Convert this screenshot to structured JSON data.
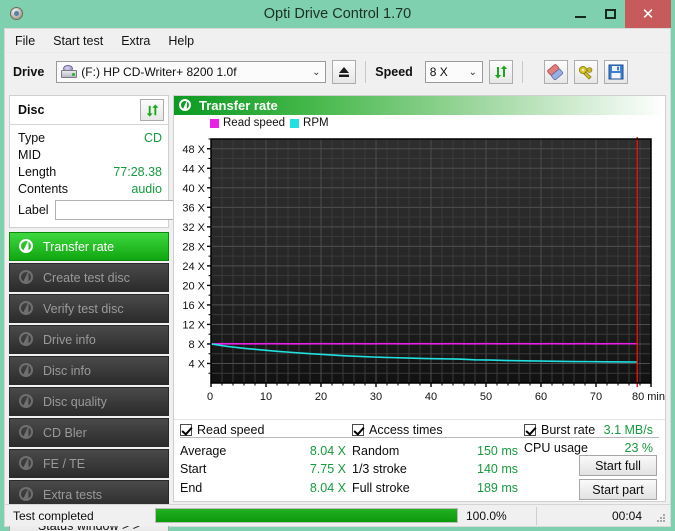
{
  "window": {
    "title": "Opti Drive Control 1.70",
    "icon": "disc-icon",
    "minimize_label": "–",
    "maximize_label": "□",
    "close_label": "✕",
    "titlebar_color": "#7fd0ae",
    "close_color": "#c75b5b"
  },
  "menu": {
    "items": [
      {
        "label": "File"
      },
      {
        "label": "Start test"
      },
      {
        "label": "Extra"
      },
      {
        "label": "Help"
      }
    ]
  },
  "toolbar": {
    "drive_label": "Drive",
    "drive_value": "(F:)   HP CD-Writer+ 8200 1.0f",
    "drive_arrow": "⌄",
    "eject_title": "eject-button",
    "speed_label": "Speed",
    "speed_value": "8 X",
    "speed_arrow": "⌄",
    "refresh_title": "refresh-button",
    "erase_title": "erase-button",
    "tools_title": "tools-button",
    "save_title": "save-button"
  },
  "disc_panel": {
    "header": "Disc",
    "refresh_icon": "refresh-icon",
    "rows": [
      {
        "key": "Type",
        "value": "CD"
      },
      {
        "key": "MID",
        "value": ""
      },
      {
        "key": "Length",
        "value": "77:28.38"
      },
      {
        "key": "Contents",
        "value": "audio"
      }
    ],
    "label_key": "Label",
    "label_value": "",
    "label_placeholder": "",
    "cd_button_icon": "cd-icon"
  },
  "sidebar": {
    "items": [
      {
        "label": "Transfer rate",
        "active": true
      },
      {
        "label": "Create test disc",
        "active": false
      },
      {
        "label": "Verify test disc",
        "active": false
      },
      {
        "label": "Drive info",
        "active": false
      },
      {
        "label": "Disc info",
        "active": false
      },
      {
        "label": "Disc quality",
        "active": false
      },
      {
        "label": "CD Bler",
        "active": false
      },
      {
        "label": "FE / TE",
        "active": false
      },
      {
        "label": "Extra tests",
        "active": false
      }
    ],
    "status_window_label": "Status window > >"
  },
  "panel": {
    "title": "Transfer rate",
    "icon": "transfer-rate-icon"
  },
  "chart_data": {
    "type": "line",
    "title": "Transfer rate",
    "xlabel": "min",
    "ylabel": "X",
    "xlim": [
      0,
      80
    ],
    "ylim": [
      0,
      50
    ],
    "xticks": [
      0,
      10,
      20,
      30,
      40,
      50,
      60,
      70,
      80
    ],
    "xtick_labels": [
      "0",
      "10",
      "20",
      "30",
      "40",
      "50",
      "60",
      "70",
      "80 min"
    ],
    "yticks": [
      4,
      8,
      12,
      16,
      20,
      24,
      28,
      32,
      36,
      40,
      44,
      48
    ],
    "ytick_labels": [
      "4 X",
      "8 X",
      "12 X",
      "16 X",
      "20 X",
      "24 X",
      "28 X",
      "32 X",
      "36 X",
      "40 X",
      "44 X",
      "48 X"
    ],
    "grid": true,
    "legend_position": "top-left",
    "background": "#222222",
    "marker_line": {
      "x": 77.5,
      "color": "#e81010",
      "label": "end-of-disc-marker"
    },
    "series": [
      {
        "name": "Read speed",
        "color": "#e820e8",
        "x": [
          0,
          2,
          5,
          8,
          11,
          14,
          17,
          20,
          23,
          26,
          29,
          32,
          35,
          38,
          41,
          44,
          47,
          50,
          53,
          56,
          59,
          62,
          65,
          68,
          71,
          74,
          77.5
        ],
        "values": [
          8.0,
          8.05,
          8.04,
          8.04,
          8.05,
          8.04,
          8.03,
          8.05,
          8.04,
          8.06,
          8.04,
          8.05,
          8.04,
          8.05,
          8.04,
          8.06,
          8.04,
          8.05,
          8.04,
          8.05,
          8.04,
          8.06,
          8.04,
          8.05,
          8.04,
          8.05,
          8.04
        ]
      },
      {
        "name": "RPM",
        "color": "#20e0e0",
        "x": [
          0,
          3,
          6,
          9,
          12,
          15,
          18,
          21,
          24,
          27,
          30,
          33,
          36,
          39,
          42,
          45,
          48,
          51,
          54,
          57,
          60,
          63,
          66,
          69,
          72,
          75,
          77.5
        ],
        "values": [
          8.0,
          7.5,
          7.1,
          6.8,
          6.5,
          6.25,
          6.0,
          5.8,
          5.6,
          5.45,
          5.3,
          5.2,
          5.1,
          5.0,
          4.95,
          4.9,
          4.75,
          4.7,
          4.6,
          4.55,
          4.5,
          4.45,
          4.4,
          4.38,
          4.35,
          4.32,
          4.3
        ]
      }
    ]
  },
  "results": {
    "read_speed": {
      "header": "Read speed",
      "checked": true,
      "rows": [
        {
          "key": "Average",
          "value": "8.04 X"
        },
        {
          "key": "Start",
          "value": "7.75 X"
        },
        {
          "key": "End",
          "value": "8.04 X"
        }
      ]
    },
    "access_times": {
      "header": "Access times",
      "checked": true,
      "rows": [
        {
          "key": "Random",
          "value": "150 ms"
        },
        {
          "key": "1/3 stroke",
          "value": "140 ms"
        },
        {
          "key": "Full stroke",
          "value": "189 ms"
        }
      ]
    },
    "burst": {
      "header": "Burst rate",
      "checked": true,
      "header_value": "3.1 MB/s",
      "cpu_key": "CPU usage",
      "cpu_value": "23 %",
      "start_full_label": "Start full",
      "start_part_label": "Start part"
    }
  },
  "statusbar": {
    "text": "Test completed",
    "progress_percent": "100.0%",
    "progress_value": 100,
    "elapsed": "00:04"
  }
}
